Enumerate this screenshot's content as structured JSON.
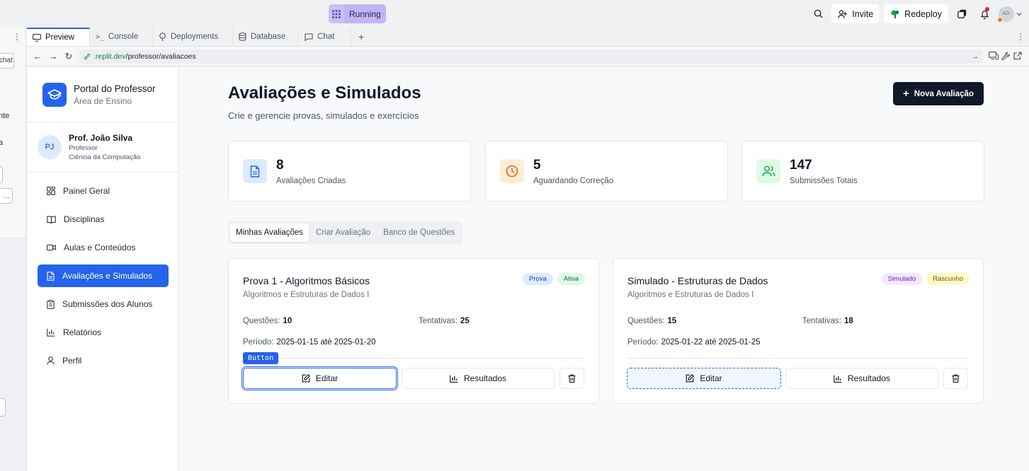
{
  "topbar": {
    "status": "Running",
    "invite_label": "Invite",
    "redeploy_label": "Redeploy",
    "avatar_initials": "AG"
  },
  "leftpanel": {
    "frag_chat": "chat",
    "frag_nte": "nte",
    "frag_a": "a"
  },
  "tabs": [
    {
      "label": "Preview",
      "icon": "monitor-icon"
    },
    {
      "label": "Console",
      "icon": "terminal-icon"
    },
    {
      "label": "Deployments",
      "icon": "deploy-icon"
    },
    {
      "label": "Database",
      "icon": "database-icon"
    },
    {
      "label": "Chat",
      "icon": "chat-icon"
    }
  ],
  "url": {
    "host": ".replit.dev",
    "path": "/professor/avaliacoes"
  },
  "sidebar": {
    "brand_title": "Portal do Professor",
    "brand_subtitle": "Área de Ensino",
    "user_initials": "PJ",
    "user_name": "Prof. João Silva",
    "user_role": "Professor",
    "user_dept": "Ciência da Computação",
    "items": [
      {
        "label": "Painel Geral",
        "icon": "dashboard-icon"
      },
      {
        "label": "Disciplinas",
        "icon": "book-icon"
      },
      {
        "label": "Aulas e Conteúdos",
        "icon": "video-icon"
      },
      {
        "label": "Avaliações e Simulados",
        "icon": "file-text-icon",
        "active": true
      },
      {
        "label": "Submissões dos Alunos",
        "icon": "clipboard-icon"
      },
      {
        "label": "Relatórios",
        "icon": "bar-chart-icon"
      },
      {
        "label": "Perfil",
        "icon": "user-icon"
      }
    ]
  },
  "main": {
    "title": "Avaliações e Simulados",
    "subtitle": "Crie e gerencie provas, simulados e exercícios",
    "new_button": "Nova Avaliação",
    "stats": [
      {
        "value": "8",
        "label": "Avaliações Criadas",
        "icon": "file-text-icon",
        "color": "#2563eb",
        "bg": "#dbeafe"
      },
      {
        "value": "5",
        "label": "Aguardando Correção",
        "icon": "clock-icon",
        "color": "#ea580c",
        "bg": "#ffedd5"
      },
      {
        "value": "147",
        "label": "Submissões Totais",
        "icon": "users-icon",
        "color": "#16a34a",
        "bg": "#dcfce7"
      }
    ],
    "tabs": [
      "Minhas Avaliações",
      "Criar Avaliação",
      "Banco de Questões"
    ],
    "cards": [
      {
        "title": "Prova 1 - Algoritmos Básicos",
        "course": "Algoritmos e Estruturas de Dados I",
        "badges": [
          {
            "label": "Prova",
            "bg": "#dbeafe",
            "color": "#1e40af"
          },
          {
            "label": "Ativa",
            "bg": "#dcfce7",
            "color": "#166534"
          }
        ],
        "questions_label": "Questões:",
        "questions": "10",
        "attempts_label": "Tentativas:",
        "attempts": "25",
        "period_label": "Período:",
        "period": "2025-01-15 até 2025-01-20",
        "edit_label": "Editar",
        "results_label": "Resultados"
      },
      {
        "title": "Simulado - Estruturas de Dados",
        "course": "Algoritmos e Estruturas de Dados I",
        "badges": [
          {
            "label": "Simulado",
            "bg": "#f3e8ff",
            "color": "#6b21a8"
          },
          {
            "label": "Rascunho",
            "bg": "#fef9c3",
            "color": "#854d0e"
          }
        ],
        "questions_label": "Questões:",
        "questions": "15",
        "attempts_label": "Tentativas:",
        "attempts": "18",
        "period_label": "Período:",
        "period": "2025-01-22 até 2025-01-25",
        "edit_label": "Editar",
        "results_label": "Resultados"
      }
    ],
    "inspector_tip": "Button"
  }
}
